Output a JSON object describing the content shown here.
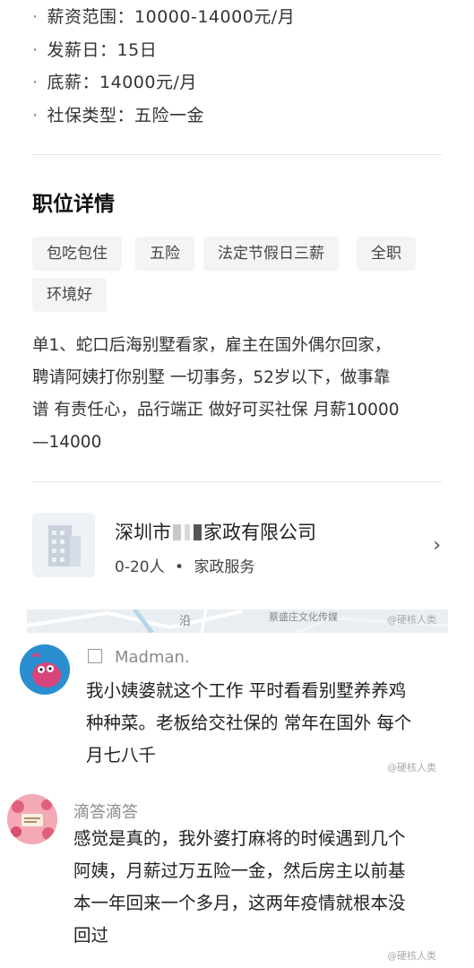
{
  "job_info": {
    "salary_range": "薪资范围：10000-14000元/月",
    "pay_day": "发薪日：15日",
    "base_salary": "底薪：14000元/月",
    "social_insurance": "社保类型：五险一金",
    "bullet": "·"
  },
  "details": {
    "title": "职位详情",
    "tags": [
      "包吃包住",
      "五险",
      "法定节假日三薪",
      "全职",
      "环境好"
    ],
    "description_lines": [
      "单1、蛇口后海别墅看家，雇主在国外偶尔回家，",
      "聘请阿姨打你别墅 一切事务，52岁以下，做事靠",
      "谱 有责任心，品行端正 做好可买社保 月薪10000",
      "—14000"
    ]
  },
  "company": {
    "name_prefix": "深圳市",
    "name_suffix": "家政有限公司",
    "size": "0-20人",
    "separator": "•",
    "industry": "家政服务",
    "chevron": "›"
  },
  "map": {
    "label_left": "沿",
    "label_right": "蔡盛庄文化传媒"
  },
  "watermark": "@硬核人类",
  "comments": [
    {
      "username": "Madman.",
      "lines": [
        "我小姨婆就这个工作 平时看看别墅养养鸡",
        "种种菜。老板给交社保的 常年在国外 每个",
        "月七八千"
      ]
    },
    {
      "username": "滴答滴答",
      "lines": [
        "感觉是真的，我外婆打麻将的时候遇到几个",
        "阿姨，月薪过万五险一金，然后房主以前基",
        "本一年回来一个多月，这两年疫情就根本没",
        "回过"
      ]
    }
  ],
  "colors": {
    "tag_bg": "#f4f4f5",
    "avatar1_bg": "#1e88c8",
    "avatar1_figure": "#d8457a",
    "avatar2_bg": "#f3a9b6"
  }
}
